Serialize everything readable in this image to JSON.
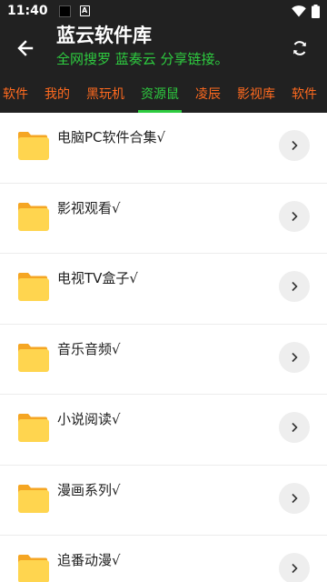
{
  "status_bar": {
    "time": "11:40"
  },
  "header": {
    "title": "蓝云软件库",
    "subtitle": "全网搜罗 蓝奏云 分享链接。"
  },
  "tabs": [
    {
      "label": "软件"
    },
    {
      "label": "我的"
    },
    {
      "label": "黑玩机"
    },
    {
      "label": "资源鼠"
    },
    {
      "label": "凌辰"
    },
    {
      "label": "影视库"
    },
    {
      "label": "软件"
    }
  ],
  "active_tab": "资源鼠",
  "items": [
    {
      "label": "电脑PC软件合集√"
    },
    {
      "label": "影视观看√"
    },
    {
      "label": "电视TV盒子√"
    },
    {
      "label": "音乐音频√"
    },
    {
      "label": "小说阅读√"
    },
    {
      "label": "漫画系列√"
    },
    {
      "label": "追番动漫√"
    }
  ],
  "colors": {
    "bar_background": "#212121",
    "accent_green": "#2ecc40",
    "tab_orange": "#ff6a1f",
    "folder_yellow": "#ffd54f"
  }
}
